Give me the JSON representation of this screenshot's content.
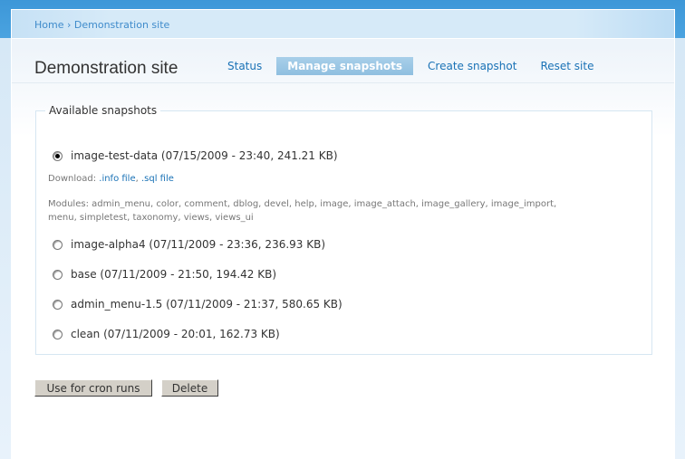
{
  "breadcrumb": {
    "home": "Home",
    "separator": "›",
    "current": "Demonstration site"
  },
  "page_title": "Demonstration site",
  "tabs": [
    {
      "label": "Status"
    },
    {
      "label": "Manage snapshots",
      "active": true
    },
    {
      "label": "Create snapshot"
    },
    {
      "label": "Reset site"
    }
  ],
  "fieldset": {
    "legend": "Available snapshots"
  },
  "snapshots": [
    {
      "label": "image-test-data (07/15/2009 - 23:40, 241.21 KB)",
      "selected": true
    },
    {
      "label": "image-alpha4 (07/11/2009 - 23:36, 236.93 KB)"
    },
    {
      "label": "base (07/11/2009 - 21:50, 194.42 KB)"
    },
    {
      "label": "admin_menu-1.5 (07/11/2009 - 21:37, 580.65 KB)"
    },
    {
      "label": "clean (07/11/2009 - 20:01, 162.73 KB)"
    }
  ],
  "download": {
    "label": "Download:",
    "info": ".info file",
    "sep": ",",
    "sql": ".sql file"
  },
  "modules": {
    "text": "Modules: admin_menu, color, comment, dblog, devel, help, image, image_attach, image_gallery, image_import,",
    "text2": "menu, simpletest, taxonomy, views, views_ui"
  },
  "buttons": {
    "cron": "Use for cron runs",
    "delete": "Delete"
  }
}
